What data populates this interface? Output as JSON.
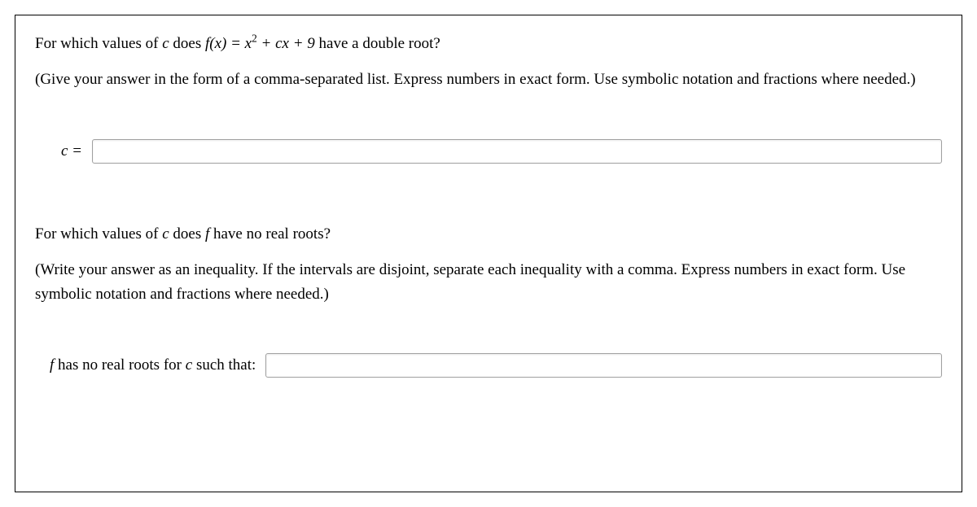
{
  "q1": {
    "prompt_pre": "For which values of ",
    "prompt_var": "c",
    "prompt_mid": " does  ",
    "func_lhs": "f(x) = x",
    "func_exp": "2",
    "func_rhs": " + cx + 9",
    "prompt_post": " have a double root?",
    "instruction": "(Give your answer in the form of a comma-separated list. Express numbers in exact form. Use symbolic notation and fractions where needed.)",
    "label": "c ="
  },
  "q2": {
    "prompt_pre": "For which values of ",
    "prompt_var": "c",
    "prompt_mid": " does  ",
    "prompt_f": "f",
    "prompt_post": " have no real roots?",
    "instruction": "(Write your answer as an inequality.  If the intervals are disjoint, separate each inequality with a comma.  Express numbers in exact form.  Use symbolic notation and fractions where needed.)",
    "label_f": "f",
    "label_rest": " has no real roots for ",
    "label_c": "c",
    "label_end": " such that:"
  },
  "inputs": {
    "c_value": "",
    "inequality_value": ""
  }
}
